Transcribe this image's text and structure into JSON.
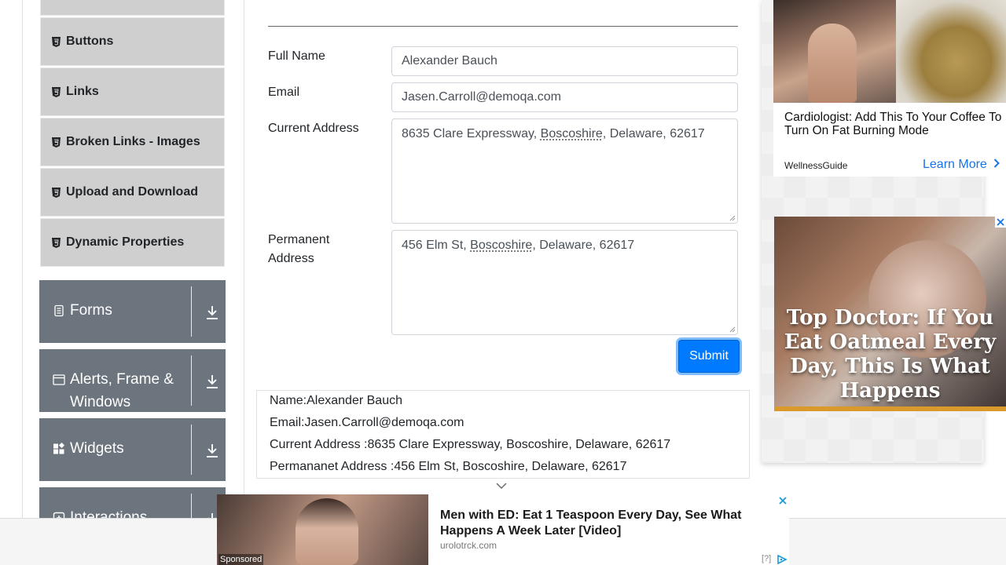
{
  "sidebar": {
    "sub_items": [
      {
        "label": "",
        "icon": "html5-icon"
      },
      {
        "label": "Buttons",
        "icon": "html5-icon"
      },
      {
        "label": "Links",
        "icon": "html5-icon"
      },
      {
        "label": "Broken Links - Images",
        "icon": "html5-icon"
      },
      {
        "label": "Upload and Download",
        "icon": "html5-icon"
      },
      {
        "label": "Dynamic Properties",
        "icon": "html5-icon"
      }
    ],
    "groups": [
      {
        "label": "Forms",
        "icon": "form-icon"
      },
      {
        "label": "Alerts, Frame &",
        "label2": "Windows",
        "icon": "window-icon"
      },
      {
        "label": "Widgets",
        "icon": "widgets-icon"
      },
      {
        "label": "Interactions",
        "icon": "interactions-icon"
      }
    ],
    "group_action_icon": "download-icon"
  },
  "form": {
    "full_name_label": "Full Name",
    "full_name_value": "Alexander Bauch",
    "email_label": "Email",
    "email_value": "Jasen.Carroll@demoqa.com",
    "current_address_label": "Current Address",
    "current_address_parts": [
      "8635 Clare Expressway, ",
      "Boscoshire",
      ", Delaware, 62617"
    ],
    "permanent_address_label_1": "Permanent",
    "permanent_address_label_2": "Address",
    "permanent_address_parts": [
      "456 Elm St, ",
      "Boscoshire",
      ", Delaware, 62617"
    ],
    "submit_label": "Submit"
  },
  "output": {
    "name": "Name:Alexander Bauch",
    "email": "Email:Jasen.Carroll@demoqa.com",
    "current_address": "Current Address :8635 Clare Expressway, Boscoshire, Delaware, 62617",
    "permanent_address": "Permananet Address :456 Elm St, Boscoshire, Delaware, 62617"
  },
  "ads": {
    "right_top": {
      "title": "Cardiologist: Add This To Your Coffee To Turn On Fat Burning Mode",
      "source": "WellnessGuide",
      "cta": "Learn More"
    },
    "right_bottom": {
      "headline": "Top Doctor: If You Eat Oatmeal Every Day, This Is What Happens"
    },
    "bottom": {
      "title": "Men with ED: Eat 1 Teaspoon Every Day, See What Happens A Week Later [Video]",
      "domain": "urolotrck.com",
      "sponsored": "Sponsored",
      "info": "[?]"
    }
  },
  "colors": {
    "primary": "#007bff",
    "group_bg": "#6c757d",
    "sub_item_bg": "#cfcfcf",
    "link": "#1a73e8"
  }
}
